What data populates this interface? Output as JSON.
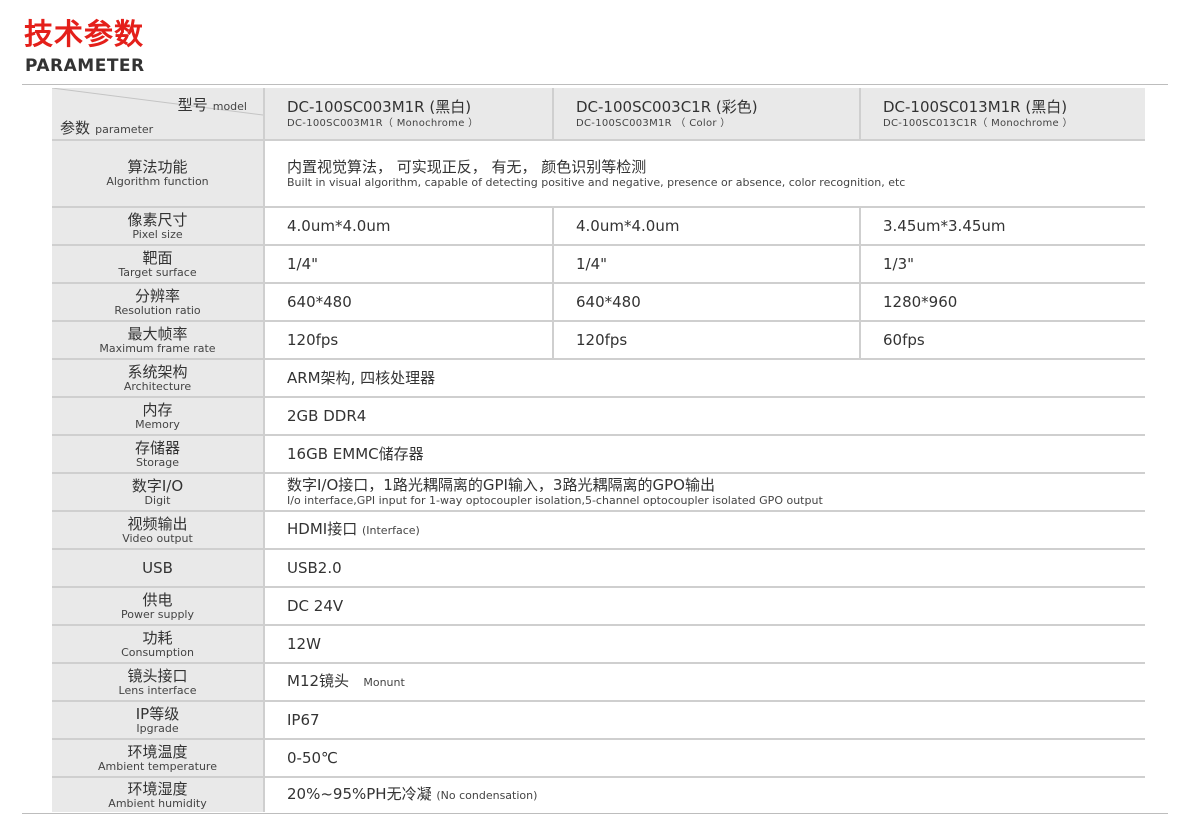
{
  "title": {
    "cn": "技术参数",
    "en": "PARAMETER"
  },
  "header": {
    "model_cn": "型号",
    "model_en": "model",
    "param_cn": "参数",
    "param_en": "parameter",
    "models": [
      {
        "name": "DC-100SC003M1R (黑白)",
        "sub": "DC-100SC003M1R（ Monochrome ）"
      },
      {
        "name": "DC-100SC003C1R (彩色)",
        "sub": "DC-100SC003M1R  （ Color ）"
      },
      {
        "name": "DC-100SC013M1R (黑白)",
        "sub": "DC-100SC013C1R（ Monochrome ）"
      }
    ]
  },
  "rows": [
    {
      "cn": "算法功能",
      "en": "Algorithm function",
      "value": "内置视觉算法， 可实现正反， 有无， 颜色识别等检测",
      "value_en": "Built in visual algorithm, capable of detecting positive and negative, presence or absence, color recognition, etc"
    },
    {
      "cn": "像素尺寸",
      "en": "Pixel size",
      "values": [
        "4.0um*4.0um",
        "4.0um*4.0um",
        "3.45um*3.45um"
      ]
    },
    {
      "cn": "靶面",
      "en": "Target surface",
      "values": [
        "1/4\"",
        "1/4\"",
        "1/3\""
      ]
    },
    {
      "cn": "分辨率",
      "en": "Resolution ratio",
      "values": [
        "640*480",
        "640*480",
        "1280*960"
      ]
    },
    {
      "cn": "最大帧率",
      "en": "Maximum frame rate",
      "values": [
        "120fps",
        "120fps",
        "60fps"
      ]
    },
    {
      "cn": "系统架构",
      "en": "Architecture",
      "value": "ARM架构, 四核处理器"
    },
    {
      "cn": "内存",
      "en": "Memory",
      "value": "2GB DDR4"
    },
    {
      "cn": "存储器",
      "en": "Storage",
      "value": "16GB  EMMC储存器"
    },
    {
      "cn": "数字I/O",
      "en": "Digit",
      "value": "数字I/O接口，1路光耦隔离的GPI输入，3路光耦隔离的GPO输出",
      "value_en": "I/o interface,GPI input for 1-way optocoupler isolation,5-channel optocoupler isolated GPO output"
    },
    {
      "cn": "视频输出",
      "en": "Video output",
      "value": "HDMI接口",
      "note": "(Interface)"
    },
    {
      "cn": "USB",
      "en": "",
      "value": "USB2.0"
    },
    {
      "cn": "供电",
      "en": "Power supply",
      "value": "DC 24V"
    },
    {
      "cn": "功耗",
      "en": "Consumption",
      "value": "12W"
    },
    {
      "cn": "镜头接口",
      "en": "Lens interface",
      "value": "M12镜头",
      "note": "Monunt"
    },
    {
      "cn": "IP等级",
      "en": "Ipgrade",
      "value": "IP67"
    },
    {
      "cn": "环境温度",
      "en": "Ambient temperature",
      "value": "0-50℃"
    },
    {
      "cn": "环境湿度",
      "en": "Ambient humidity",
      "value": "20%~95%PH无冷凝",
      "note": "(No condensation)"
    }
  ]
}
